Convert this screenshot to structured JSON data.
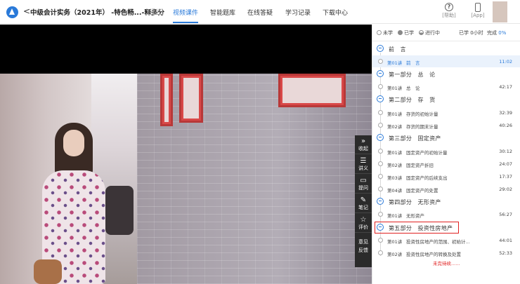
{
  "header": {
    "back_symbol": "<",
    "course_title": "中级会计实务（2021年） -特色畅...-释多分",
    "rate_link": "[评价]",
    "nav": [
      {
        "label": "视频课件",
        "active": true
      },
      {
        "label": "智能题库",
        "active": false
      },
      {
        "label": "在线答疑",
        "active": false
      },
      {
        "label": "学习记录",
        "active": false
      },
      {
        "label": "下载中心",
        "active": false
      }
    ],
    "help_label": "[帮助]",
    "app_label": "[App]",
    "help_glyph": "?",
    "accent_color": "#2a7ad9"
  },
  "sidetools": [
    {
      "icon": "»",
      "icon_name": "collapse-icon",
      "label": "收起"
    },
    {
      "icon": "☰",
      "icon_name": "list-icon",
      "label": "讲义"
    },
    {
      "icon": "▭",
      "icon_name": "comment-icon",
      "label": "提问"
    },
    {
      "icon": "✎",
      "icon_name": "note-icon",
      "label": "笔记"
    },
    {
      "icon": "☆",
      "icon_name": "star-icon",
      "label": "评价"
    },
    {
      "icon": "",
      "icon_name": "",
      "label": "意见反馈"
    }
  ],
  "panel": {
    "legend": {
      "not_studied": "未学",
      "studied": "已学",
      "in_progress": "进行中"
    },
    "progress": {
      "studied_label": "已学 0小时",
      "complete_label": "完成",
      "complete_value": "0%"
    },
    "parts": [
      {
        "label": "前　言",
        "lessons": [
          {
            "num": "第01讲",
            "title": "前　言",
            "duration": "11:02",
            "current": true
          }
        ]
      },
      {
        "label": "第一部分　总　论",
        "lessons": [
          {
            "num": "第01讲",
            "title": "总　论",
            "duration": "42:17",
            "current": false
          }
        ]
      },
      {
        "label": "第二部分　存　货",
        "lessons": [
          {
            "num": "第01讲",
            "title": "存货的初始计量",
            "duration": "32:39",
            "current": false
          },
          {
            "num": "第02讲",
            "title": "存货的期末计量",
            "duration": "40:26",
            "current": false
          }
        ]
      },
      {
        "label": "第三部分　固定资产",
        "lessons": [
          {
            "num": "第01讲",
            "title": "固定资产的初始计量",
            "duration": "30:12",
            "current": false
          },
          {
            "num": "第02讲",
            "title": "固定资产折旧",
            "duration": "24:07",
            "current": false
          },
          {
            "num": "第03讲",
            "title": "固定资产的后续支出",
            "duration": "17:37",
            "current": false
          },
          {
            "num": "第04讲",
            "title": "固定资产的处置",
            "duration": "29:02",
            "current": false
          }
        ]
      },
      {
        "label": "第四部分　无形资产",
        "lessons": [
          {
            "num": "第01讲",
            "title": "无形资产",
            "duration": "56:27",
            "current": false
          }
        ]
      },
      {
        "label": "第五部分　投资性房地产",
        "highlighted": true,
        "lessons": [
          {
            "num": "第01讲",
            "title": "投资性房地产的范围、初始计...",
            "duration": "44:01",
            "current": false
          },
          {
            "num": "第02讲",
            "title": "投资性房地产的转换及处置",
            "duration": "52:33",
            "current": false
          }
        ]
      }
    ],
    "continued_text": "未完待续......",
    "highlight_color": "#e02020"
  }
}
